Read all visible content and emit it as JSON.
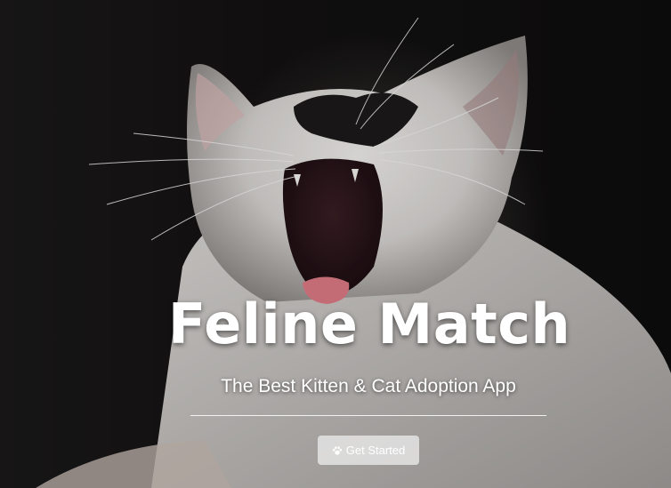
{
  "hero": {
    "title": "Feline Match",
    "subtitle": "The Best Kitten & Cat Adoption App",
    "background_image": "yawning white-and-black cat",
    "cta": {
      "label": "Get Started",
      "icon": "paw-icon"
    }
  },
  "colors": {
    "text": "#ffffff",
    "button_bg": "#e8e8e8",
    "background": "#111010"
  }
}
